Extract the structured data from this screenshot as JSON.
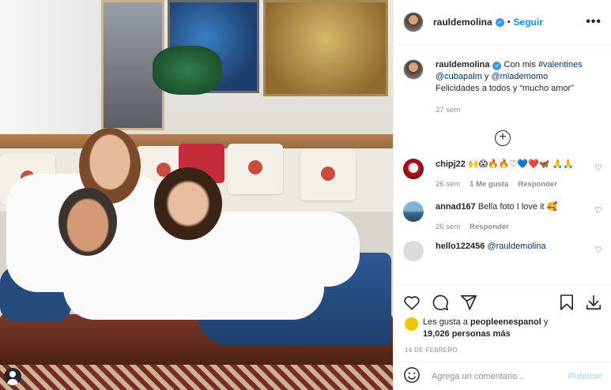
{
  "post": {
    "user_tag_icon": "person-icon",
    "photo_alt": ""
  },
  "header": {
    "username": "rauldemolina",
    "separator": "•",
    "follow_label": "Seguir",
    "more_label": "•••"
  },
  "caption": {
    "username": "rauldemolina",
    "text_prefix": "Con mis ",
    "hashtag": "#valentines",
    "mention1": "@cubapalm",
    "conj": " y ",
    "mention2": "@miademomo",
    "line2": "Felicidades a todos y “mucho amor”",
    "time": "27 sem"
  },
  "load_more_label": "+",
  "comments": [
    {
      "username": "chipj22",
      "text": "🙌😱🔥🔥♡💙❤️🦋 🙏🙏",
      "time": "26 sem",
      "likes": "1 Me gusta",
      "reply": "Responder"
    },
    {
      "username": "annad167",
      "text": "Bella foto I love it 🥰",
      "time": "26 sem",
      "reply": "Responder"
    },
    {
      "username": "hello122456",
      "text": "@rauldemolina"
    }
  ],
  "likes": {
    "prefix": "Les gusta a ",
    "user": "peopleenespanol",
    "conj": " y",
    "count": "19,026 personas más"
  },
  "date": "14 DE FEBRERO",
  "add_comment": {
    "placeholder": "Agrega un comentario...",
    "publish": "Publicar"
  },
  "colors": {
    "link": "#00376b",
    "follow": "#0095f6",
    "verified": "#3897f0",
    "publish_disabled": "#b2dffc"
  }
}
